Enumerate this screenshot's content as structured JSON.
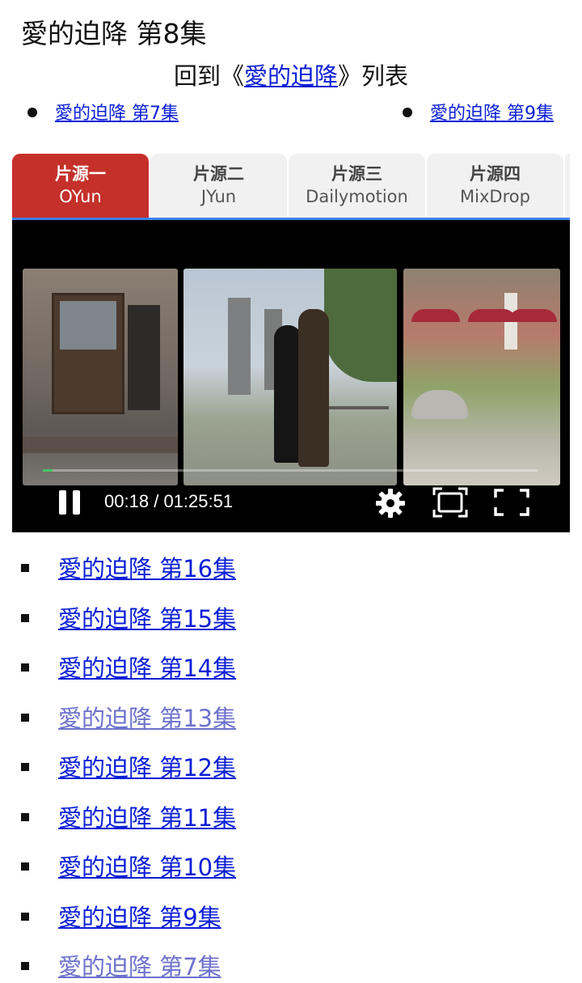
{
  "page": {
    "title": "愛的迫降 第8集",
    "back_prefix": "回到《",
    "back_link": "愛的迫降",
    "back_suffix": "》列表",
    "prev_link": "愛的迫降 第7集",
    "next_link": "愛的迫降 第9集"
  },
  "tabs": [
    {
      "label": "片源一",
      "source": "OYun",
      "active": true
    },
    {
      "label": "片源二",
      "source": "JYun",
      "active": false
    },
    {
      "label": "片源三",
      "source": "Dailymotion",
      "active": false
    },
    {
      "label": "片源四",
      "source": "MixDrop",
      "active": false
    }
  ],
  "player": {
    "current_time": "00:18",
    "separator": "/",
    "duration": "01:25:51",
    "progress_fraction": 0.0035,
    "icons": [
      "pause-icon",
      "gear-icon",
      "cast-icon",
      "fullscreen-icon"
    ]
  },
  "episodes": [
    {
      "label": "愛的迫降 第16集",
      "visited": false
    },
    {
      "label": "愛的迫降 第15集",
      "visited": false
    },
    {
      "label": "愛的迫降 第14集",
      "visited": false
    },
    {
      "label": "愛的迫降 第13集",
      "visited": true
    },
    {
      "label": "愛的迫降 第12集",
      "visited": false
    },
    {
      "label": "愛的迫降 第11集",
      "visited": false
    },
    {
      "label": "愛的迫降 第10集",
      "visited": false
    },
    {
      "label": "愛的迫降 第9集",
      "visited": false
    },
    {
      "label": "愛的迫降 第7集",
      "visited": true
    }
  ],
  "colors": {
    "active_tab": "#c5302a",
    "link": "#0b1fd6",
    "visited_link": "#6d72cc",
    "tab_underline": "#3b82f6",
    "progress_fill": "#47c760"
  }
}
